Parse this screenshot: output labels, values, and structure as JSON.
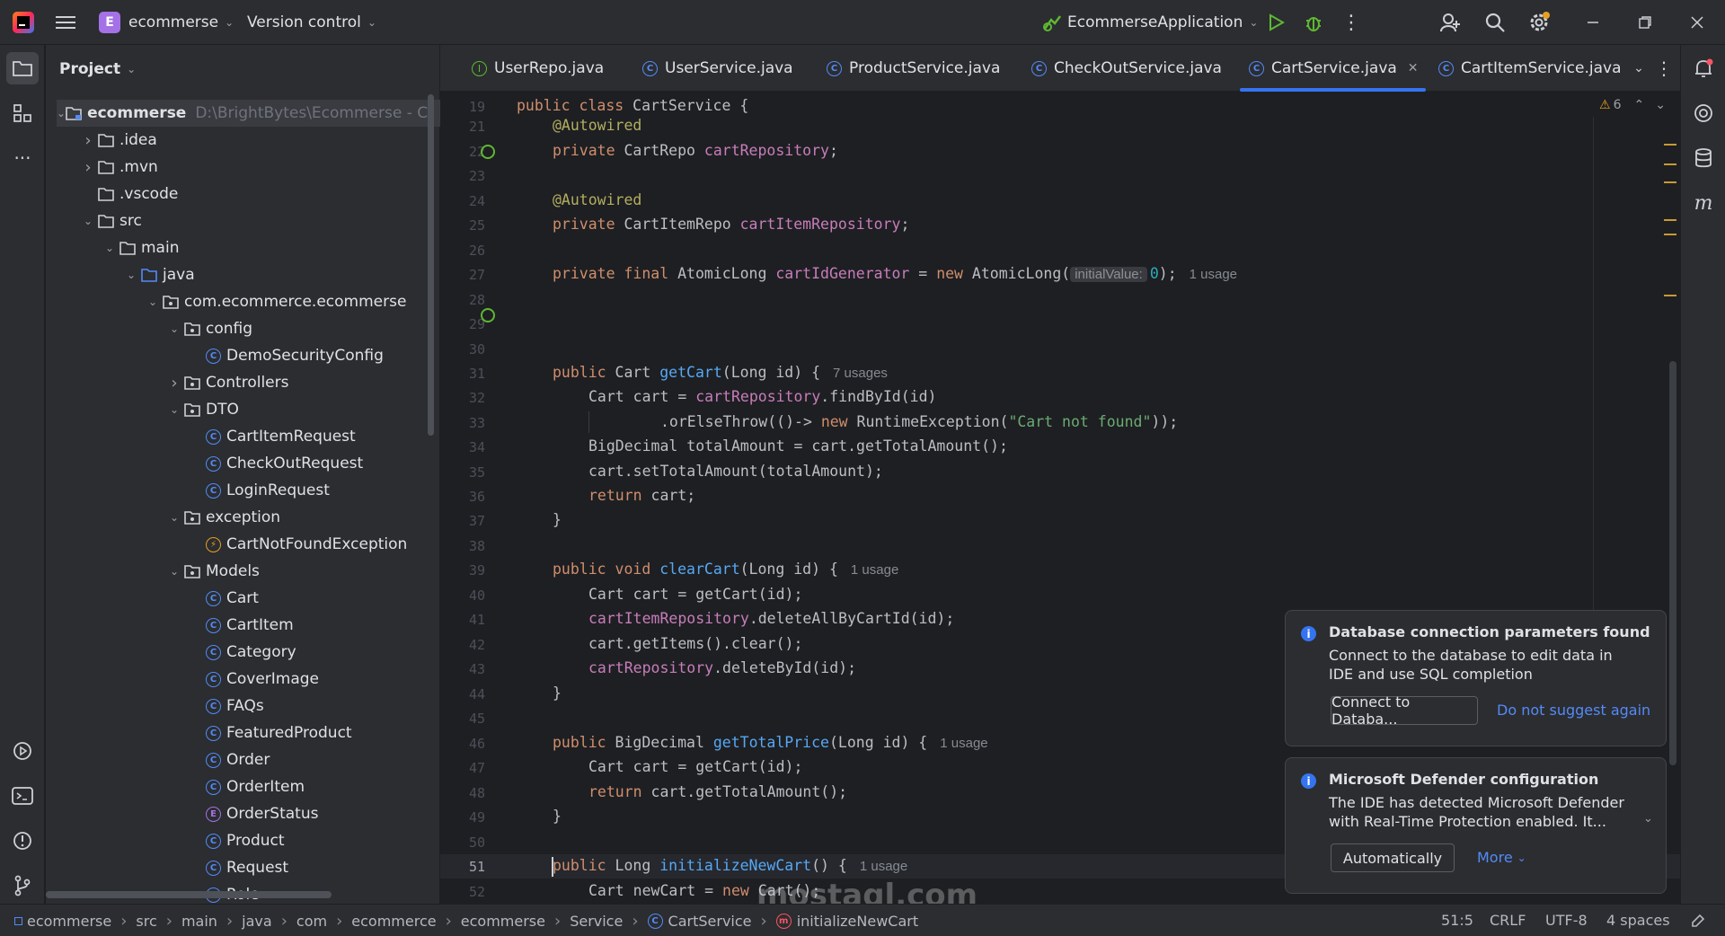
{
  "titlebar": {
    "project_letter": "E",
    "project_name": "ecommerse",
    "vcs": "Version control",
    "run_config": "EcommerseApplication"
  },
  "project_panel": {
    "title": "Project",
    "root_name": "ecommerse",
    "root_path": "D:\\BrightBytes\\Ecommerse - Copy",
    "items": [
      ".idea",
      ".mvn",
      ".vscode",
      "src",
      "main",
      "java",
      "com.ecommerce.ecommerse",
      "config",
      "DemoSecurityConfig",
      "Controllers",
      "DTO",
      "CartItemRequest",
      "CheckOutRequest",
      "LoginRequest",
      "exception",
      "CartNotFoundException",
      "Models",
      "Cart",
      "CartItem",
      "Category",
      "CoverImage",
      "FAQs",
      "FeaturedProduct",
      "Order",
      "OrderItem",
      "OrderStatus",
      "Product",
      "Request",
      "Role"
    ]
  },
  "tabs": [
    "UserRepo.java",
    "UserService.java",
    "ProductService.java",
    "CheckOutService.java",
    "CartService.java",
    "CartItemService.java"
  ],
  "editor": {
    "warning_count": "6",
    "line_numbers": [
      "19",
      "21",
      "22",
      "23",
      "24",
      "25",
      "26",
      "27",
      "28",
      "29",
      "30",
      "31",
      "32",
      "33",
      "34",
      "35",
      "36",
      "37",
      "38",
      "39",
      "40",
      "41",
      "42",
      "43",
      "44",
      "45",
      "46",
      "47",
      "48",
      "49",
      "50",
      "51",
      "52"
    ],
    "usages": {
      "l27": "1 usage",
      "l31": "7 usages",
      "l39": "1 usage",
      "l46": "1 usage",
      "l51": "1 usage"
    },
    "inlay_initial": "initialValue:"
  },
  "notifications": [
    {
      "title": "Database connection parameters found",
      "body1": "Connect to the database to edit data in",
      "body2": "IDE and use SQL completion",
      "button": "Connect to Databa...",
      "link": "Do not suggest again"
    },
    {
      "title": "Microsoft Defender configuration",
      "body1": "The IDE has detected Microsoft Defender",
      "body2": "with Real-Time Protection enabled. It...",
      "button": "Automatically",
      "link": "More"
    }
  ],
  "statusbar": {
    "breadcrumbs": [
      "ecommerse",
      "src",
      "main",
      "java",
      "com",
      "ecommerce",
      "ecommerse",
      "Service",
      "CartService",
      "initializeNewCart"
    ],
    "position": "51:5",
    "line_sep": "CRLF",
    "encoding": "UTF-8",
    "indent": "4 spaces"
  },
  "watermark": "mostaql.com"
}
